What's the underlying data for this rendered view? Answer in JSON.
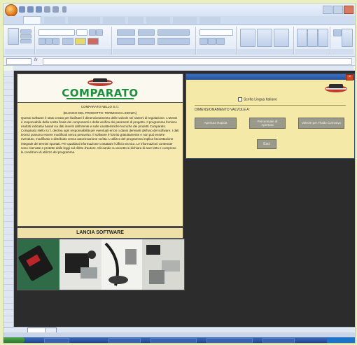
{
  "brand": {
    "name": "COMPARATO"
  },
  "text_panel": {
    "heading_lines": [
      "COMPARATO NELLO S.r.l.",
      "(ELENCO DEL PRODOTTO: TERMINI DI LICENZA)"
    ],
    "body": "Questo software è stato creato per facilitare il dimensionamento delle valvole nei sistemi di regolazione. L'utente è responsabile della scelta finale dei componenti e della verifica dei parametri di progetto. Il programma fornisce risultati indicativi basati sui dati inseriti dall'utente e sulle caratteristiche tecniche dei prodotti Comparato. Comparato Nello S.r.l. declina ogni responsabilità per eventuali errori o danni derivanti dall'uso del software. I dati tecnici possono essere modificati senza preavviso. Il software è fornito gratuitamente e non può essere rivenduto, modificato o distribuito senza autorizzazione scritta. L'utilizzo del programma implica l'accettazione integrale dei termini riportati. Per qualsiasi informazione contattare l'ufficio tecnico. Le informazioni contenute sono riservate e protette dalle leggi sul diritto d'autore. Cliccando su accetto si dichiara di aver letto e compreso le condizioni di utilizzo del programma."
  },
  "lancia_label": "LANCIA SOFTWARE",
  "dialog": {
    "close": "×",
    "checkbox_label": "Scelta Lingua Italiano",
    "question": "DIMENSIONAMENTO VALVOLE A:",
    "buttons": [
      "Apertura Rapida",
      "Percentuale di Apertura",
      "Valvole per Fluido Corrosivo"
    ],
    "ok": "Esci"
  },
  "colors": {
    "brand_green": "#1d8f3e",
    "panel_cream": "#f6eab0",
    "dialog_title": "#3a6fc2"
  }
}
